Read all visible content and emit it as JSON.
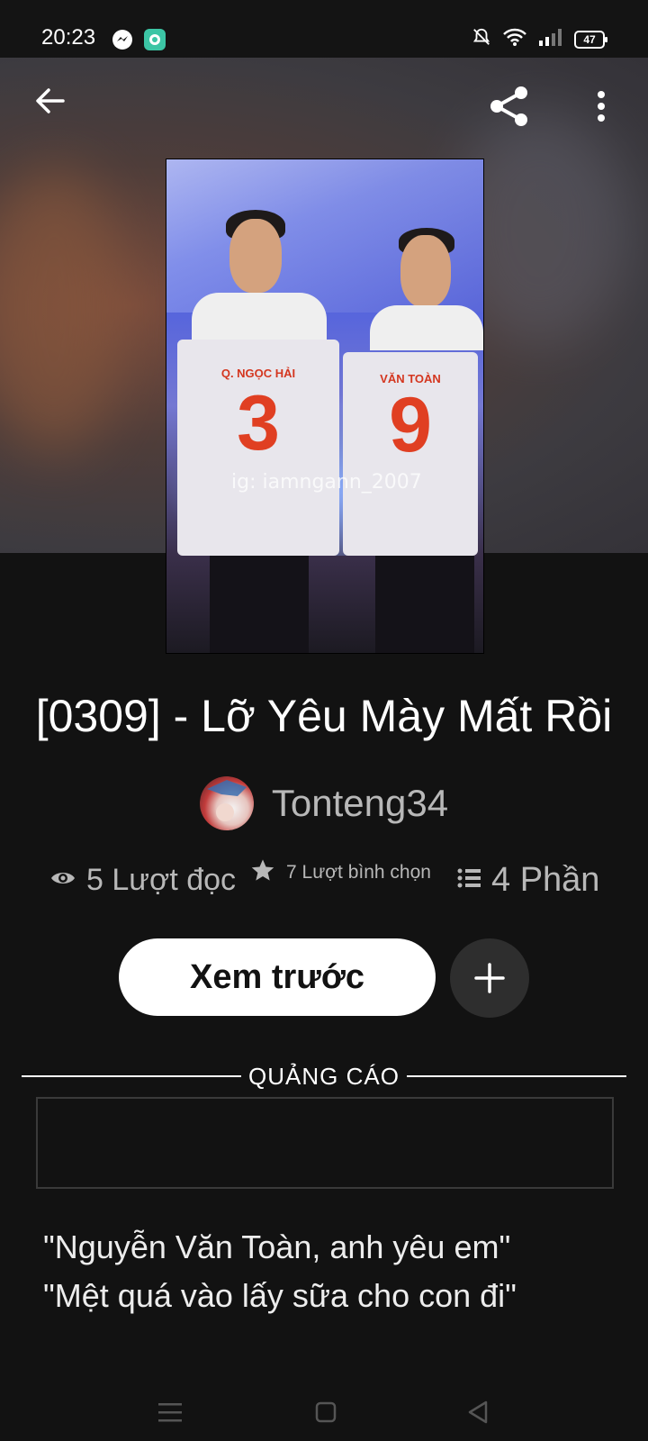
{
  "status_bar": {
    "time": "20:23",
    "battery": "47"
  },
  "book": {
    "title": "[0309] - Lỡ Yêu Mày Mất Rồi",
    "author": "Tonteng34",
    "cover": {
      "watermark": "ig: iamngann_2007",
      "left_shirt_name": "Q. NGỌC HẢI",
      "left_shirt_number": "3",
      "right_shirt_name": "VĂN TOÀN",
      "right_shirt_number": "9"
    }
  },
  "stats": {
    "reads": "5 Lượt đọc",
    "votes": "7 Lượt bình chọn",
    "parts": "4 Phần"
  },
  "actions": {
    "preview_label": "Xem trước"
  },
  "ad": {
    "label": "QUẢNG CÁO"
  },
  "description": {
    "line1": "\"Nguyễn Văn Toàn, anh yêu em\"",
    "line2": "\"Mệt quá vào lấy sữa cho con đi\""
  },
  "colors": {
    "background": "#121212",
    "button": "#ffffff",
    "muted_text": "#b8b8b8"
  }
}
